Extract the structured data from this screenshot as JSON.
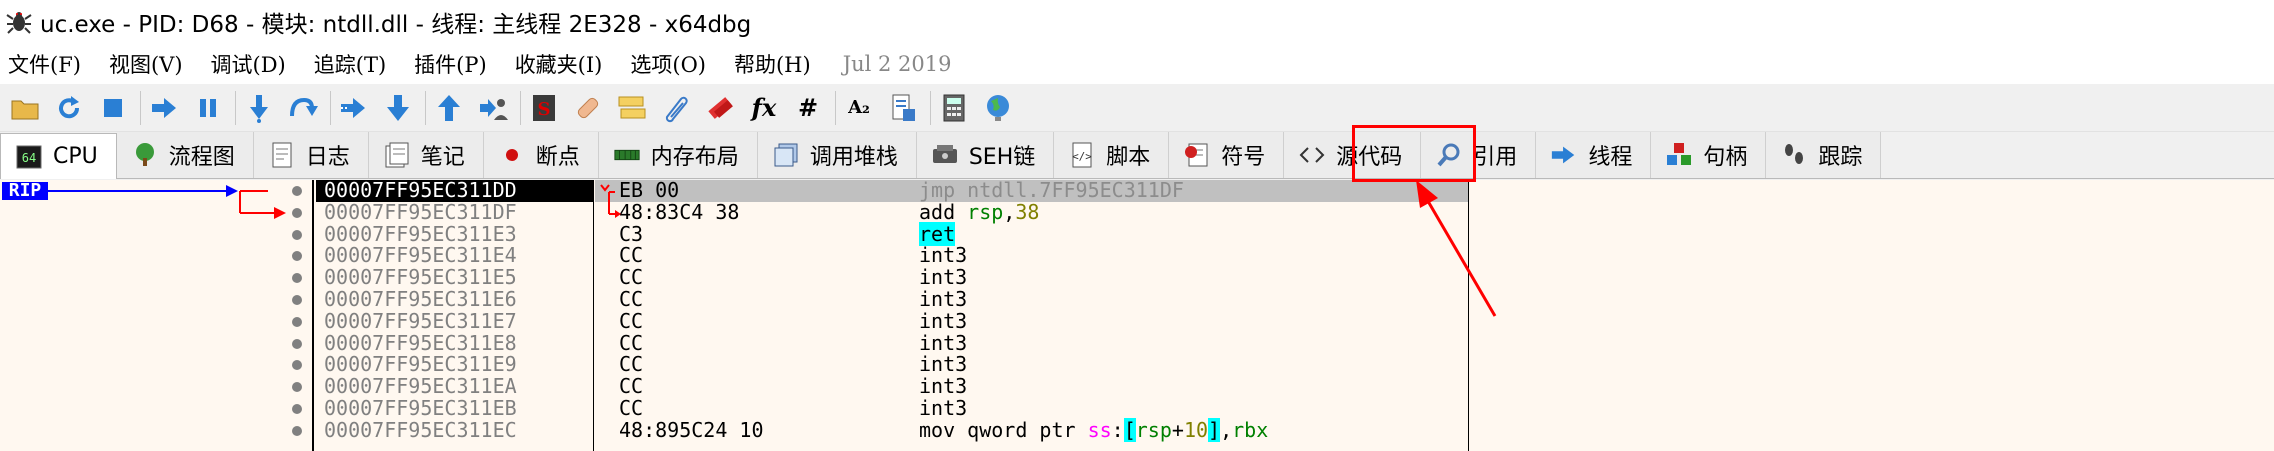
{
  "title": {
    "text": "uc.exe - PID: D68 - 模块: ntdll.dll - 线程: 主线程 2E328 - x64dbg",
    "icon": "bug-icon"
  },
  "menu": {
    "items": [
      {
        "label": "文件(F)"
      },
      {
        "label": "视图(V)"
      },
      {
        "label": "调试(D)"
      },
      {
        "label": "追踪(T)"
      },
      {
        "label": "插件(P)"
      },
      {
        "label": "收藏夹(I)"
      },
      {
        "label": "选项(O)"
      },
      {
        "label": "帮助(H)"
      }
    ],
    "date": "Jul 2 2019"
  },
  "toolbar": {
    "fx_label": "fx",
    "hash_label": "#",
    "font_label": "A₂"
  },
  "tabs": [
    {
      "label": "CPU",
      "icon": "cpu-icon"
    },
    {
      "label": "流程图",
      "icon": "tree-icon"
    },
    {
      "label": "日志",
      "icon": "log-icon"
    },
    {
      "label": "笔记",
      "icon": "notes-icon"
    },
    {
      "label": "断点",
      "icon": "breakpoint-icon"
    },
    {
      "label": "内存布局",
      "icon": "memory-icon"
    },
    {
      "label": "调用堆栈",
      "icon": "callstack-icon"
    },
    {
      "label": "SEH链",
      "icon": "seh-icon"
    },
    {
      "label": "脚本",
      "icon": "script-icon"
    },
    {
      "label": "符号",
      "icon": "symbol-icon"
    },
    {
      "label": "源代码",
      "icon": "source-icon"
    },
    {
      "label": "引用",
      "icon": "reference-icon"
    },
    {
      "label": "线程",
      "icon": "thread-icon"
    },
    {
      "label": "句柄",
      "icon": "handle-icon"
    },
    {
      "label": "跟踪",
      "icon": "trace-icon"
    }
  ],
  "disasm": {
    "rip_label": "RIP",
    "rows": [
      {
        "addr": "00007FF95EC311DD",
        "bytes": "EB 00",
        "instr": "jmp ntdll.7FF95EC311DF"
      },
      {
        "addr": "00007FF95EC311DF",
        "bytes": "48:83C4 38",
        "instr": "add rsp,38"
      },
      {
        "addr": "00007FF95EC311E3",
        "bytes": "C3",
        "instr": "ret"
      },
      {
        "addr": "00007FF95EC311E4",
        "bytes": "CC",
        "instr": "int3"
      },
      {
        "addr": "00007FF95EC311E5",
        "bytes": "CC",
        "instr": "int3"
      },
      {
        "addr": "00007FF95EC311E6",
        "bytes": "CC",
        "instr": "int3"
      },
      {
        "addr": "00007FF95EC311E7",
        "bytes": "CC",
        "instr": "int3"
      },
      {
        "addr": "00007FF95EC311E8",
        "bytes": "CC",
        "instr": "int3"
      },
      {
        "addr": "00007FF95EC311E9",
        "bytes": "CC",
        "instr": "int3"
      },
      {
        "addr": "00007FF95EC311EA",
        "bytes": "CC",
        "instr": "int3"
      },
      {
        "addr": "00007FF95EC311EB",
        "bytes": "CC",
        "instr": "int3"
      },
      {
        "addr": "00007FF95EC311EC",
        "bytes": "48:895C24 10",
        "instr": "mov qword ptr ss:[rsp+10],rbx"
      }
    ]
  },
  "colors": {
    "highlight": "#ff0000",
    "rip": "#0000ff",
    "jump_arrow": "#ff0000"
  }
}
